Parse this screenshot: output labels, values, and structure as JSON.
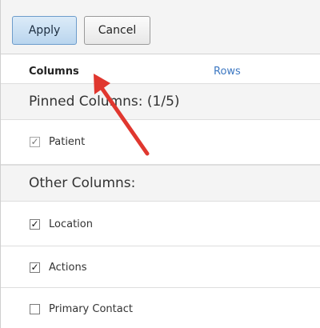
{
  "toolbar": {
    "apply_label": "Apply",
    "cancel_label": "Cancel"
  },
  "tabs": {
    "columns_label": "Columns",
    "rows_label": "Rows"
  },
  "pinned": {
    "header": "Pinned Columns: (1/5)",
    "items": [
      {
        "label": "Patient",
        "checked": true,
        "disabled": true
      }
    ]
  },
  "other": {
    "header": "Other Columns:",
    "items": [
      {
        "label": "Location",
        "checked": true
      },
      {
        "label": "Actions",
        "checked": true
      },
      {
        "label": "Primary Contact",
        "checked": false
      }
    ]
  },
  "annotation": {
    "arrow_color": "#e0372f"
  }
}
